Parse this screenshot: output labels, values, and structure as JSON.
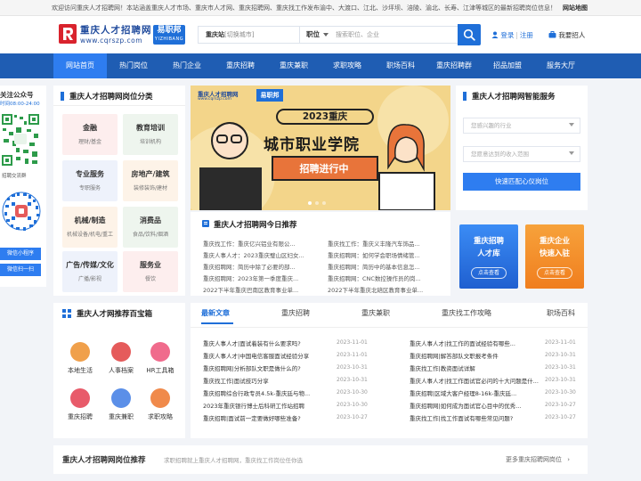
{
  "topbar": {
    "notice": "欢迎访问重庆人才招聘网！本站涵盖重庆人才市场、重庆市人才网、重庆招聘网、重庆找工作发布渝中、大渡口、江北、沙坪坝、涪陵、渝北、长寿、江津等城区的最新招聘岗位信息！",
    "sitemap": "网站地图"
  },
  "header": {
    "logo_title": "重庆人才招聘网",
    "logo_domain": "www.cqrszp.com",
    "yzb_main": "易职邦",
    "yzb_sub": "YIZHIBANG",
    "city_label": "重庆站",
    "city_switch": "[切换城市]",
    "position_label": "职位",
    "search_placeholder": "搜索职位、企业",
    "login": "登录",
    "register": "注册",
    "recruit": "我要招人"
  },
  "nav": [
    "网站首页",
    "热门岗位",
    "热门企业",
    "重庆招聘",
    "重庆兼职",
    "求职攻略",
    "职场百科",
    "重庆招聘群",
    "招品加盟",
    "服务大厅"
  ],
  "qr": {
    "title": "关注公众号",
    "time": "时间08:00-24:00",
    "caption": "招聘交流群",
    "btn1": "微信小程序",
    "btn2": "微信扫一扫"
  },
  "categories": {
    "title": "重庆人才招聘网岗位分类",
    "items": [
      {
        "t": "金融",
        "s": "理财/基金"
      },
      {
        "t": "教育培训",
        "s": "培训机构"
      },
      {
        "t": "专业服务",
        "s": "专职服务"
      },
      {
        "t": "房地产/建筑",
        "s": "装修装饰/建材"
      },
      {
        "t": "机械/制造",
        "s": "机械设备/机电/重工"
      },
      {
        "t": "消费品",
        "s": "食品/饮料/烟酒"
      },
      {
        "t": "广告/传媒/文化",
        "s": "广播/影视"
      },
      {
        "t": "服务业",
        "s": "餐饮"
      }
    ]
  },
  "banner": {
    "brand": "重庆人才招聘网",
    "brand_sub": "www.cqrszp.com",
    "yzb": "易职邦",
    "year": "2023重庆",
    "headline": "城市职业学院",
    "badge": "招聘进行中"
  },
  "news": {
    "title": "重庆人才招聘网今日推荐",
    "left": [
      "重庆找工作：重庆亿兴铝业有限公...",
      "重庆人事人才：2023重庆璧山区妇女...",
      "重庆招聘网：简历中除了必要的部...",
      "重庆招聘网：2023年第一季度重庆...",
      "2022下半年重庆巴南区教育事业单..."
    ],
    "right": [
      "重庆找工作：重庆义丰隆汽车饰品...",
      "重庆招聘网：如何学会职场情绪管...",
      "重庆招聘网：简历中的基本信息怎...",
      "重庆招聘网：CNC数控操作员的岗...",
      "2022下半年重庆北碚区教育事业单..."
    ]
  },
  "service": {
    "title": "重庆人才招聘网智能服务",
    "industry_placeholder": "您感兴趣的行业",
    "salary_placeholder": "您愿意达到的收入范围",
    "btn": "快速匹配心仪岗位",
    "promo1_line1": "重庆招聘",
    "promo1_line2": "人才库",
    "promo1_btn": "点击查看",
    "promo2_line1": "重庆企业",
    "promo2_line2": "快速入驻",
    "promo2_btn": "点击查看"
  },
  "toolbox": {
    "title": "重庆人才网推荐百宝箱",
    "items": [
      {
        "l": "本地生活",
        "c": "#f0a04b"
      },
      {
        "l": "人事档案",
        "c": "#e55b5b"
      },
      {
        "l": "HR工具箱",
        "c": "#f06b8c"
      },
      {
        "l": "重庆招聘",
        "c": "#e85b6a"
      },
      {
        "l": "重庆兼职",
        "c": "#5b8fe8"
      },
      {
        "l": "求职攻略",
        "c": "#f08a4b"
      }
    ]
  },
  "tabs": {
    "labels": [
      "最新文章",
      "重庆招聘",
      "重庆兼职",
      "重庆找工作攻略",
      "职场百科"
    ],
    "left": [
      {
        "t": "重庆人事人才|面试着装有什么要求吗?",
        "d": "2023-11-01"
      },
      {
        "t": "重庆人事人才|中国电信客服面试经验分享",
        "d": "2023-11-01"
      },
      {
        "t": "重庆招聘网|分析部队文职是做什么的?",
        "d": "2023-10-31"
      },
      {
        "t": "重庆找工作|面试技巧分享",
        "d": "2023-10-31"
      },
      {
        "t": "重庆招聘综合行政专员4.5k-重庆廷与物...",
        "d": "2023-10-30"
      },
      {
        "t": "2023年重庆银行博士后科研工作站招聘",
        "d": "2023-10-30"
      },
      {
        "t": "重庆招聘|面试前一定要做好哪些准备?",
        "d": "2023-10-27"
      }
    ],
    "right": [
      {
        "t": "重庆人事人才|找工作的面试经验有哪些...",
        "d": "2023-11-01"
      },
      {
        "t": "重庆招聘网|解答部队文职报考条件",
        "d": "2023-10-31"
      },
      {
        "t": "重庆找工作|教资面试详解",
        "d": "2023-10-31"
      },
      {
        "t": "重庆人事人才|找工作面试官必问的十大问题是什...",
        "d": "2023-10-31"
      },
      {
        "t": "重庆招聘|区域大客户经理8-16k-重庆廷...",
        "d": "2023-10-30"
      },
      {
        "t": "重庆招聘网|如何成为面试官心目中的优秀...",
        "d": "2023-10-27"
      },
      {
        "t": "重庆找工作|找工作面试有哪些常见问题?",
        "d": "2023-10-27"
      }
    ]
  },
  "recommend": {
    "title": "重庆人才招聘网岗位推荐",
    "sub": "求职招聘就上重庆人才招聘网，重庆找工作岗位任你选",
    "more": "更多重庆招聘网岗位"
  }
}
